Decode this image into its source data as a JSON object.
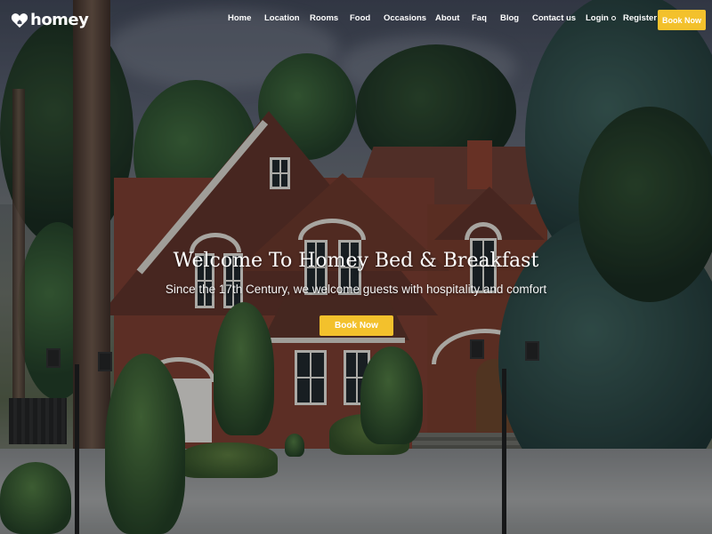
{
  "brand": {
    "name": "homey",
    "logo_icon": "heart-house-icon"
  },
  "nav": {
    "items": [
      {
        "label": "Home"
      },
      {
        "label": "Location"
      },
      {
        "label": "Rooms"
      },
      {
        "label": "Food"
      },
      {
        "label": "Occasions"
      },
      {
        "label": "About"
      },
      {
        "label": "Faq"
      },
      {
        "label": "Blog"
      },
      {
        "label": "Contact us"
      }
    ],
    "login_label": "Login",
    "register_label": "Register",
    "book_label": "Book Now"
  },
  "hero": {
    "title": "Welcome To Homey Bed & Breakfast",
    "subtitle": "Since the 17th Century, we welcome guests with hospitality and comfort",
    "cta_label": "Book Now"
  },
  "colors": {
    "accent": "#f3c12c",
    "text": "#ffffff"
  }
}
